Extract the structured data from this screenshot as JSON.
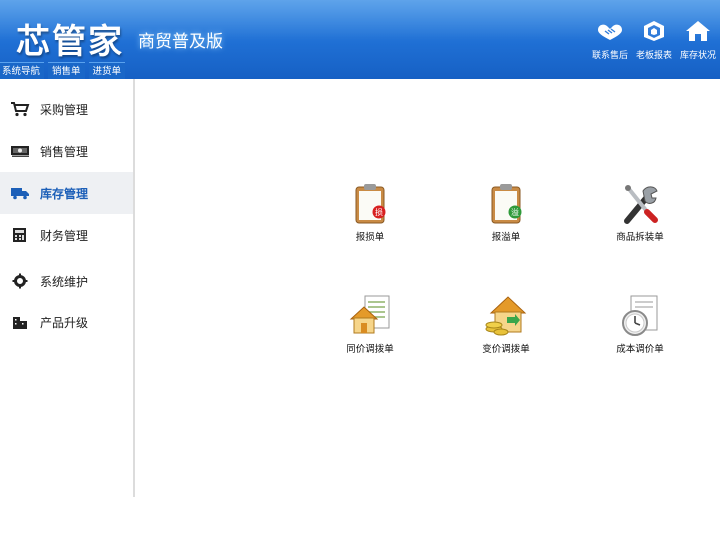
{
  "header": {
    "logo": "芯管家",
    "edition": "商贸普及版",
    "tabs": [
      "系统导航",
      "销售单",
      "进货单"
    ],
    "actions": [
      {
        "label": "联系售后",
        "icon": "handshake-icon"
      },
      {
        "label": "老板报表",
        "icon": "cube-report-icon"
      },
      {
        "label": "库存状况",
        "icon": "home-icon"
      }
    ]
  },
  "sidebar": {
    "items": [
      {
        "label": "采购管理",
        "icon": "cart-icon"
      },
      {
        "label": "销售管理",
        "icon": "money-icon"
      },
      {
        "label": "库存管理",
        "icon": "truck-icon",
        "active": true
      },
      {
        "label": "财务管理",
        "icon": "calculator-icon"
      },
      {
        "label": "系统维护",
        "icon": "gear-icon"
      },
      {
        "label": "产品升级",
        "icon": "building-icon"
      }
    ]
  },
  "functions": [
    {
      "label": "报损单",
      "icon": "clipboard-loss-icon",
      "badge": "损"
    },
    {
      "label": "报溢单",
      "icon": "clipboard-overflow-icon",
      "badge": "溢"
    },
    {
      "label": "商品拆装单",
      "icon": "tools-icon"
    },
    {
      "label": "同价调拨单",
      "icon": "house-document-icon"
    },
    {
      "label": "变价调拨单",
      "icon": "house-coins-icon"
    },
    {
      "label": "成本调价单",
      "icon": "clock-document-icon"
    }
  ],
  "colors": {
    "header": "#1f6fd4",
    "active_sidebar_text": "#1c5fb8",
    "active_sidebar_bg": "#eef0f3"
  }
}
